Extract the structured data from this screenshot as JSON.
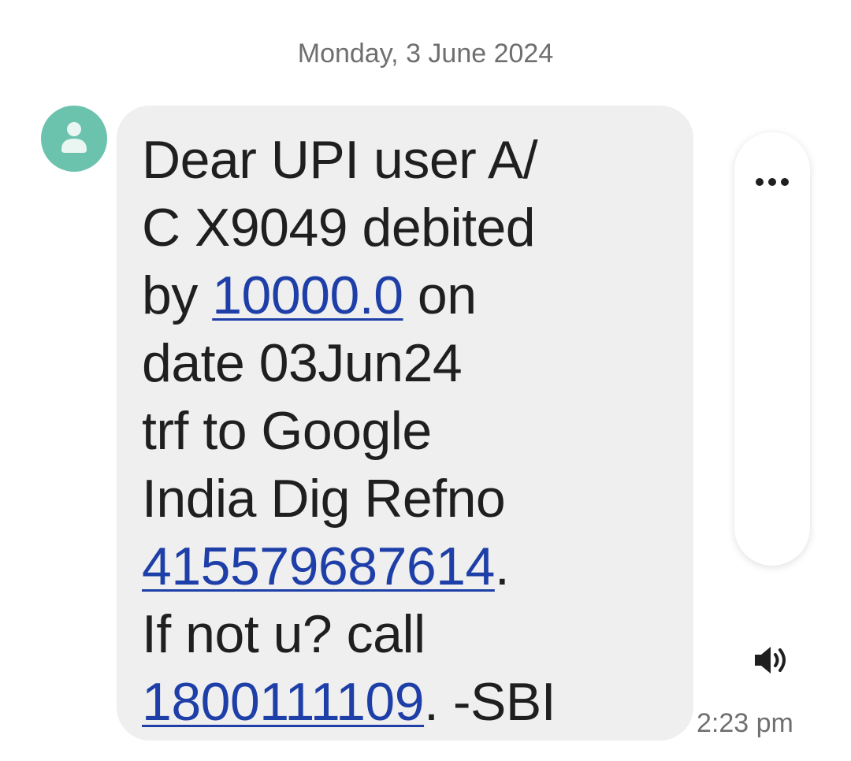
{
  "date_header": "Monday, 3 June 2024",
  "avatar": {
    "icon": "person-icon",
    "color": "#6cc3ad"
  },
  "message": {
    "line1": "Dear UPI user A/",
    "line2": "C X9049 debited",
    "line3_prefix": "by ",
    "amount_link": "10000.0",
    "line3_suffix": " on",
    "line4": "date 03Jun24",
    "line5": "trf to Google",
    "line6": "India Dig Refno",
    "refno_link": "415579687614",
    "line7_suffix": ".",
    "line8": "If not u? call",
    "phone_link": "1800111109",
    "line9_suffix": ". -SBI"
  },
  "actions": {
    "more_icon": "more-horizontal-icon",
    "speak_icon": "speaker-icon"
  },
  "timestamp": "2:23 pm",
  "colors": {
    "bubble": "#efefef",
    "link": "#1e3fa8",
    "text": "#1f1f1f",
    "muted": "#6f6f6f"
  }
}
